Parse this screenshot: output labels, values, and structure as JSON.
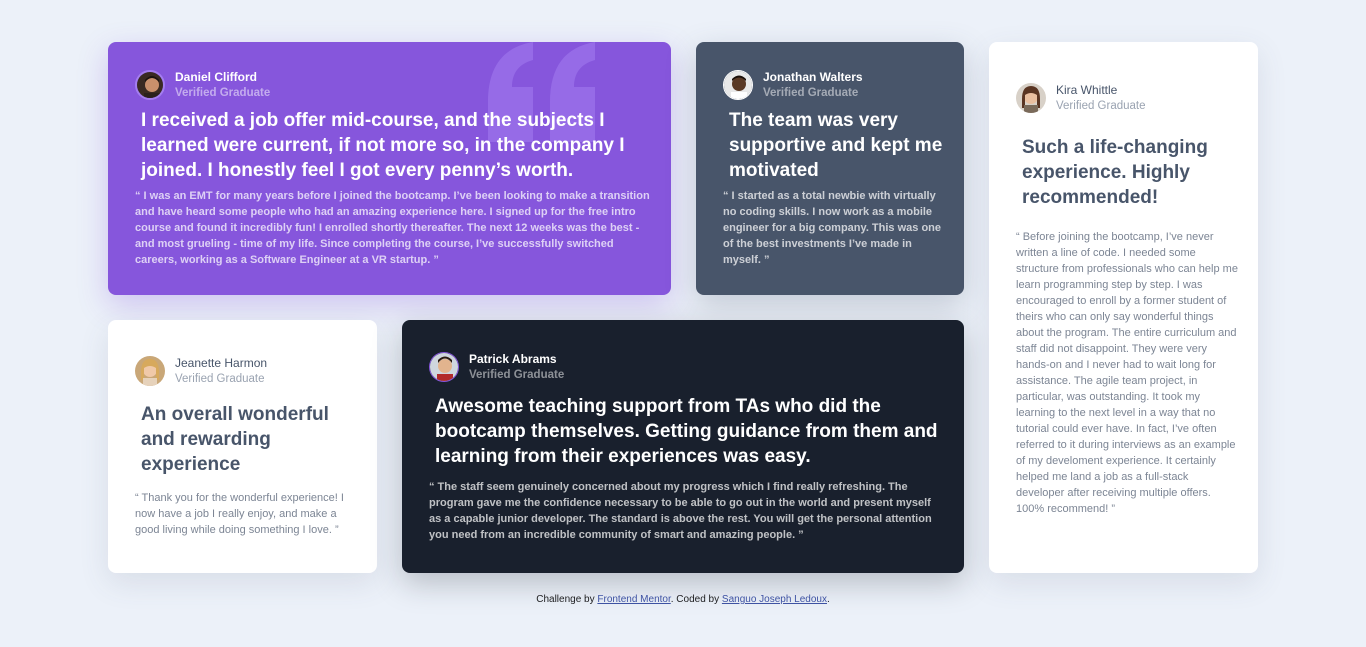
{
  "testimonials": [
    {
      "name": "Daniel Clifford",
      "role": "Verified Graduate",
      "headline": "I received a job offer mid-course, and the subjects I learned were current, if not more so, in the company I joined. I honestly feel I got every penny’s worth.",
      "body": "“ I was an EMT for many years before I joined the bootcamp. I’ve been looking to make a transition and have heard some people who had an amazing experience here. I signed up for the free intro course and found it incredibly fun! I enrolled shortly thereafter. The next 12 weeks was the best - and most grueling - time of my life. Since completing the course, I’ve successfully switched careers, working as a Software Engineer at a VR startup. ”"
    },
    {
      "name": "Jonathan Walters",
      "role": "Verified Graduate",
      "headline": "The team was very supportive and kept me motivated",
      "body": "“ I started as a total newbie with virtually no coding skills. I now work as a mobile engineer for a big company. This was one of the best investments I’ve made in myself. ”"
    },
    {
      "name": "Jeanette Harmon",
      "role": "Verified Graduate",
      "headline": "An overall wonderful and rewarding experience",
      "body": "“ Thank you for the wonderful experience! I now have a job I really enjoy, and make a good living while doing something I love. ”"
    },
    {
      "name": "Patrick Abrams",
      "role": "Verified Graduate",
      "headline": "Awesome teaching support from TAs who did the bootcamp themselves. Getting guidance from them and learning from their experiences was easy.",
      "body": "“ The staff seem genuinely concerned about my progress which I find really refreshing. The program gave me the confidence necessary to be able to go out in the world and present myself as a capable junior developer. The standard is above the rest. You will get the personal attention you need from an incredible community of smart and amazing people. ”"
    },
    {
      "name": "Kira Whittle",
      "role": "Verified Graduate",
      "headline": "Such a life-changing experience. Highly recommended!",
      "body": "“ Before joining the bootcamp, I’ve never written a line of code. I needed some structure from professionals who can help me learn programming step by step. I was encouraged to enroll by a former student of theirs who can only say wonderful things about the program. The entire curriculum and staff did not disappoint. They were very hands-on and I never had to wait long for assistance. The agile team project, in particular, was outstanding. It took my learning to the next level in a way that no tutorial could ever have. In fact, I’ve often referred to it during interviews as an example of my develoment experience. It certainly helped me land a job as a full-stack developer after receiving multiple offers. 100% recommend! ”"
    }
  ],
  "footer": {
    "prefix": "Challenge by",
    "link1": "Frontend Mentor",
    "middle": ". Coded by",
    "link2": "Sanguo Joseph Ledoux",
    "suffix": "."
  },
  "colors": {
    "background": "#ecf1f9",
    "purple": "#8656dc",
    "slate": "#48556a",
    "dark": "#19202d",
    "white": "#ffffff"
  },
  "icons": [
    "quotation-mark-icon"
  ]
}
